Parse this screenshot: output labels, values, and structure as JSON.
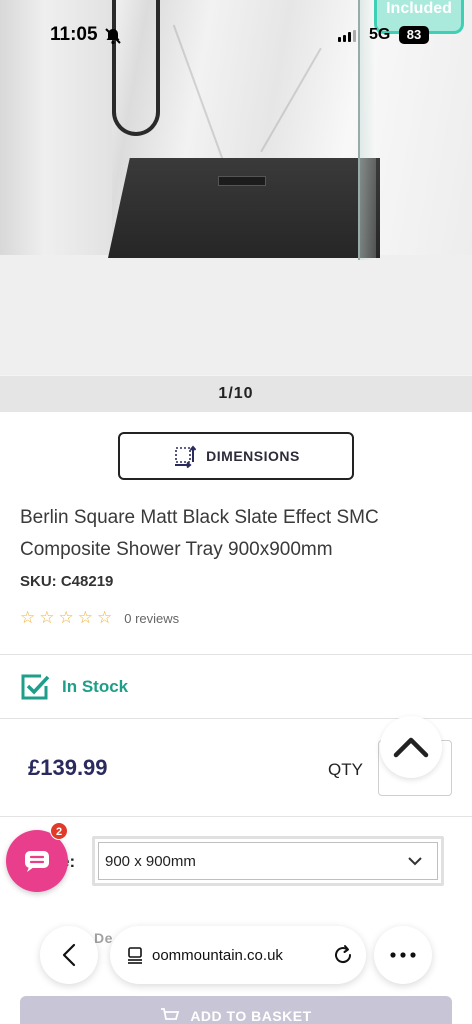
{
  "status_bar": {
    "time": "11:05",
    "network": "5G",
    "battery": "83"
  },
  "gallery": {
    "counter": "1/10",
    "badge_text": "Included"
  },
  "dimensions_button": {
    "label": "DIMENSIONS"
  },
  "product": {
    "title": "Berlin Square Matt Black Slate Effect SMC Composite Shower Tray 900x900mm",
    "sku": "SKU: C48219",
    "rating": 0,
    "reviews": "0 reviews",
    "stock": "In Stock",
    "price": "£139.99",
    "qty_label": "QTY",
    "size_label": "e:",
    "size_value": "900 x 900mm",
    "delivery_text": "Dе",
    "add_to_basket": "ADD TO BASKET"
  },
  "chat": {
    "badge_count": "2"
  },
  "browser": {
    "url": "oommountain.co.uk"
  },
  "colors": {
    "brand_navy": "#2b2a5e",
    "stock_green": "#1f9e8a",
    "chat_pink": "#e83e8c",
    "star": "#f2b233"
  }
}
